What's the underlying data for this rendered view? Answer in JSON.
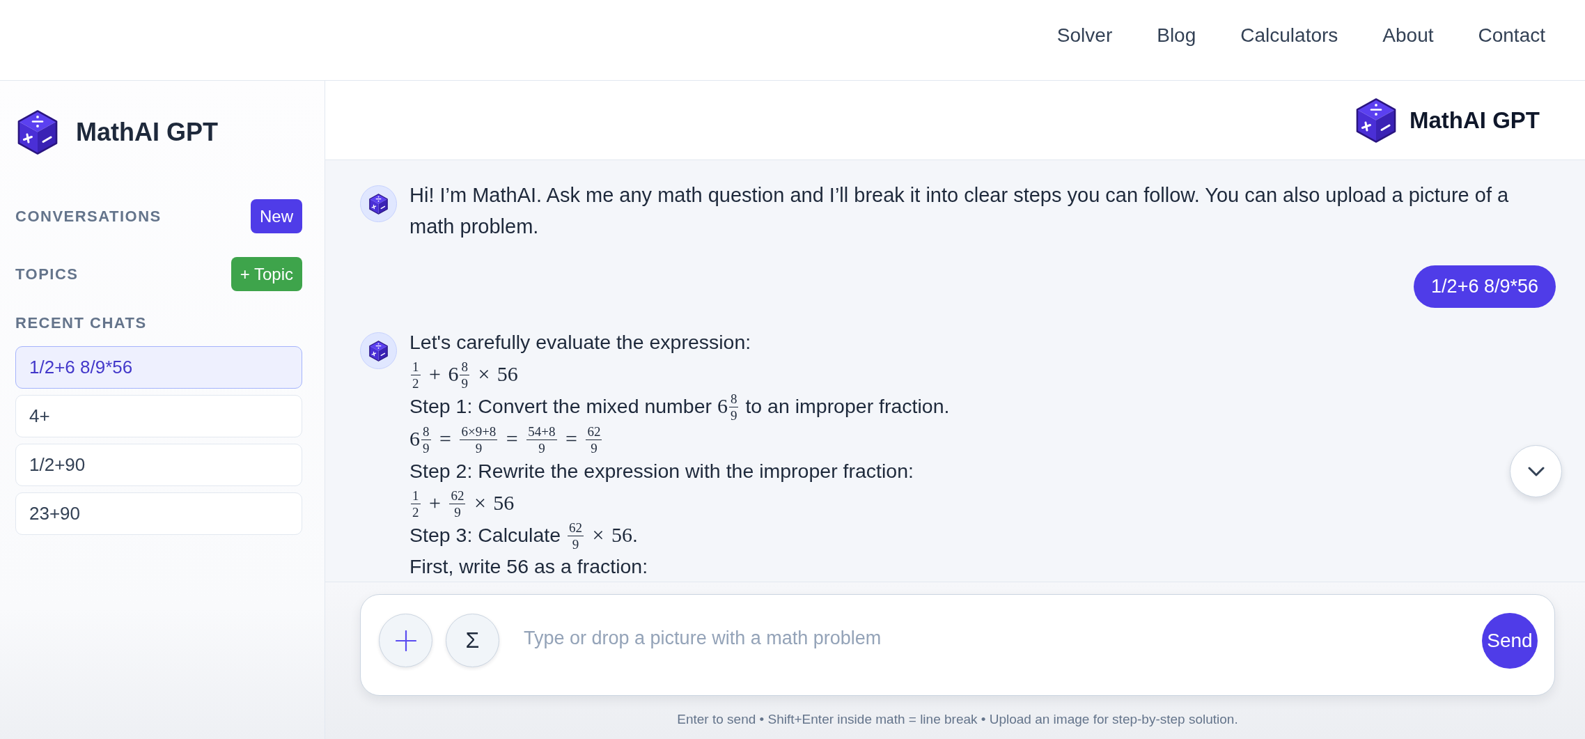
{
  "nav": {
    "links": [
      "Solver",
      "Blog",
      "Calculators",
      "About",
      "Contact"
    ]
  },
  "sidebar": {
    "title": "MathAI GPT",
    "sections": [
      {
        "label": "CONVERSATIONS",
        "button": {
          "label": "New",
          "kind": "primary"
        }
      },
      {
        "label": "TOPICS",
        "button": {
          "label": "+ Topic",
          "kind": "success"
        }
      }
    ],
    "recent_label": "RECENT CHATS",
    "recent_chats": [
      {
        "label": "1/2+6 8/9*56",
        "selected": true
      },
      {
        "label": "4+",
        "selected": false
      },
      {
        "label": "1/2+90",
        "selected": false
      },
      {
        "label": "23+90",
        "selected": false
      }
    ]
  },
  "header": {
    "title": "MathAI GPT"
  },
  "messages": [
    {
      "kind": "bot",
      "lines": [
        {
          "kind": "text",
          "parts": [
            {
              "kind": "text",
              "text": "Hi! I’m MathAI. Ask me any math question and I’ll break it into clear steps you can follow. You can also upload a picture of a math problem."
            }
          ]
        }
      ]
    },
    {
      "kind": "user",
      "text": "1/2+6 8/9*56"
    },
    {
      "kind": "bot",
      "lines": [
        {
          "kind": "text",
          "parts": [
            {
              "kind": "text",
              "text": "Let's carefully evaluate the expression:"
            }
          ]
        },
        {
          "kind": "math",
          "parts": [
            {
              "kind": "frac",
              "num": "1",
              "den": "2"
            },
            {
              "kind": "op",
              "text": "+"
            },
            {
              "kind": "num",
              "text": "6"
            },
            {
              "kind": "frac",
              "num": "8",
              "den": "9"
            },
            {
              "kind": "op",
              "text": "×"
            },
            {
              "kind": "num",
              "text": "56"
            }
          ]
        },
        {
          "kind": "text",
          "parts": [
            {
              "kind": "text",
              "text": "Step 1: Convert the mixed number "
            },
            {
              "kind": "num",
              "text": "6"
            },
            {
              "kind": "frac",
              "num": "8",
              "den": "9"
            },
            {
              "kind": "text",
              "text": " to an improper fraction."
            }
          ]
        },
        {
          "kind": "math",
          "parts": [
            {
              "kind": "num",
              "text": "6"
            },
            {
              "kind": "frac",
              "num": "8",
              "den": "9"
            },
            {
              "kind": "op",
              "text": "="
            },
            {
              "kind": "frac",
              "num": "6×9+8",
              "den": "9"
            },
            {
              "kind": "op",
              "text": "="
            },
            {
              "kind": "frac",
              "num": "54+8",
              "den": "9"
            },
            {
              "kind": "op",
              "text": "="
            },
            {
              "kind": "frac",
              "num": "62",
              "den": "9"
            }
          ]
        },
        {
          "kind": "text",
          "parts": [
            {
              "kind": "text",
              "text": "Step 2: Rewrite the expression with the improper fraction:"
            }
          ]
        },
        {
          "kind": "math",
          "parts": [
            {
              "kind": "frac",
              "num": "1",
              "den": "2"
            },
            {
              "kind": "op",
              "text": "+"
            },
            {
              "kind": "frac",
              "num": "62",
              "den": "9"
            },
            {
              "kind": "op",
              "text": "×"
            },
            {
              "kind": "num",
              "text": "56"
            }
          ]
        },
        {
          "kind": "text",
          "parts": [
            {
              "kind": "text",
              "text": "Step 3: Calculate "
            },
            {
              "kind": "frac",
              "num": "62",
              "den": "9"
            },
            {
              "kind": "op",
              "text": "×"
            },
            {
              "kind": "num",
              "text": "56"
            },
            {
              "kind": "text",
              "text": "."
            }
          ]
        },
        {
          "kind": "text",
          "parts": [
            {
              "kind": "text",
              "text": "First, write 56 as a fraction:"
            }
          ]
        }
      ]
    }
  ],
  "composer": {
    "placeholder": "Type or drop a picture with a math problem",
    "symbol_button": "Σ",
    "send_button": "Send",
    "hint": "Enter to send • Shift+Enter inside math = line break • Upload an image for step-by-step solution."
  }
}
